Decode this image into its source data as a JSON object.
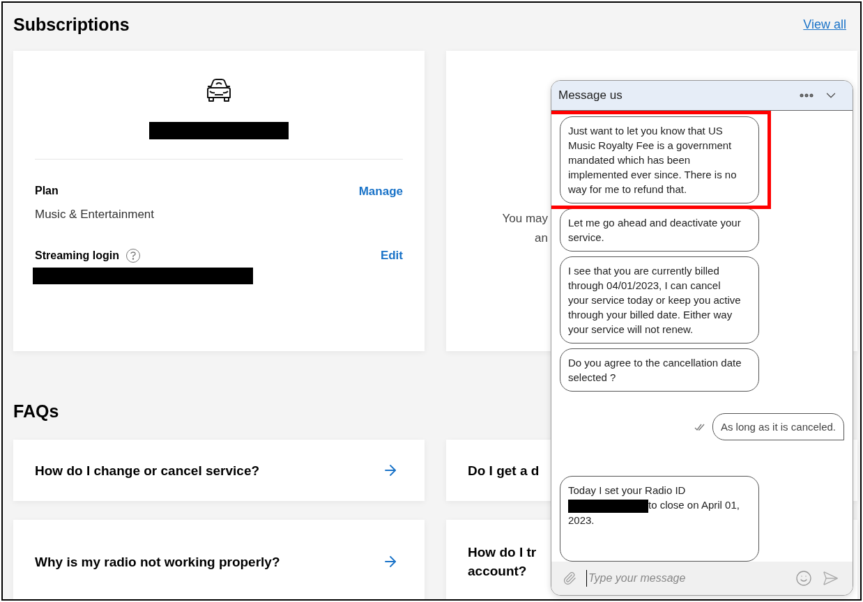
{
  "header": {
    "title": "Subscriptions",
    "link": "View all"
  },
  "subscription_card": {
    "plan_label": "Plan",
    "plan_value": "Music & Entertainment",
    "plan_action": "Manage",
    "login_label": "Streaming login",
    "login_action": "Edit"
  },
  "side_card": {
    "lines": [
      "You may",
      "an"
    ]
  },
  "faqs": {
    "title": "FAQs",
    "items": [
      {
        "lines": [
          "How do I change or cancel service?"
        ],
        "arrow": true
      },
      {
        "lines": [
          "Why is my radio not working properly?"
        ],
        "arrow": true
      },
      {
        "lines": [
          "Do I get a d"
        ],
        "arrow": false
      },
      {
        "lines": [
          "How do I tr",
          "account?"
        ],
        "arrow": false
      }
    ]
  },
  "chat": {
    "title": "Message us",
    "messages": [
      {
        "kind": "agent",
        "text": "Just want to let you know that US Music Royalty Fee is a government mandated which has been implemented ever since. There is no way for me to refund that.",
        "highlighted": true
      },
      {
        "kind": "agent",
        "text": "Let me go ahead and deactivate your service.",
        "highlighted": false
      },
      {
        "kind": "agent",
        "text": "I see that you are currently billed through 04/01/2023, I can cancel your service today or keep you active through your billed date. Either way your service will not renew.",
        "highlighted": false
      },
      {
        "kind": "agent",
        "text": "Do you agree to the cancellation date selected ?",
        "highlighted": false
      },
      {
        "kind": "user",
        "text": "As long as it is canceled.",
        "read": true
      },
      {
        "kind": "agent_redacted",
        "before": "Today I set your Radio ID",
        "after": "to close on April 01, 2023.",
        "highlighted": false
      }
    ],
    "input": {
      "placeholder": "Type your message"
    }
  }
}
